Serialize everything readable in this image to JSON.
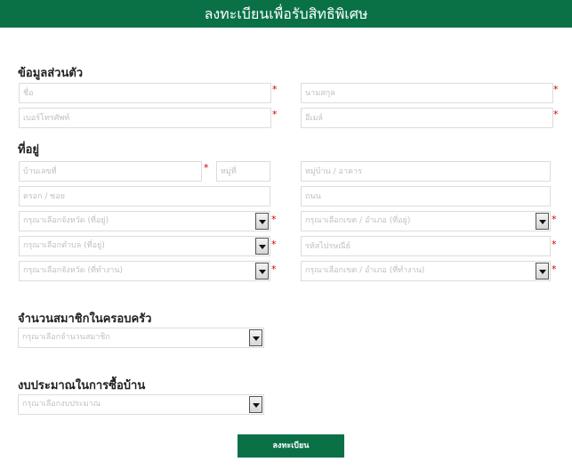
{
  "header": {
    "title": "ลงทะเบียนเพื่อรับสิทธิพิเศษ"
  },
  "sections": {
    "personal": "ข้อมูลส่วนตัว",
    "address": "ที่อยู่",
    "family": "จำนวนสมาชิกในครอบครัว",
    "budget": "งบประมาณในการซื้อบ้าน"
  },
  "fields": {
    "first_name": "ชื่อ",
    "last_name": "นามสกุล",
    "phone": "เบอร์โทรศัพท์",
    "email": "อีเมล์",
    "house_no": "บ้านเลขที่",
    "moo": "หมู่ที่",
    "village": "หมู่บ้าน / อาคาร",
    "soi": "ตรอก / ซอย",
    "road": "ถนน",
    "province_home": "กรุณาเลือกจังหวัด (ที่อยู่)",
    "district_home": "กรุณาเลือกเขต / อำเภอ (ที่อยู่)",
    "subdistrict_home": "กรุณาเลือกตำบล (ที่อยู่)",
    "postcode": "รหัสไปรษณีย์",
    "province_work": "กรุณาเลือกจังหวัด (ที่ทำงาน)",
    "district_work": "กรุณาเลือกเขต / อำเภอ (ที่ทำงาน)",
    "family_members": "กรุณาเลือกจำนวนสมาชิก",
    "budget": "กรุณาเลือกงบประมาณ"
  },
  "required_mark": "*",
  "submit_label": "ลงทะเบียน",
  "colors": {
    "brand": "#0a7147",
    "required": "#d40000"
  }
}
